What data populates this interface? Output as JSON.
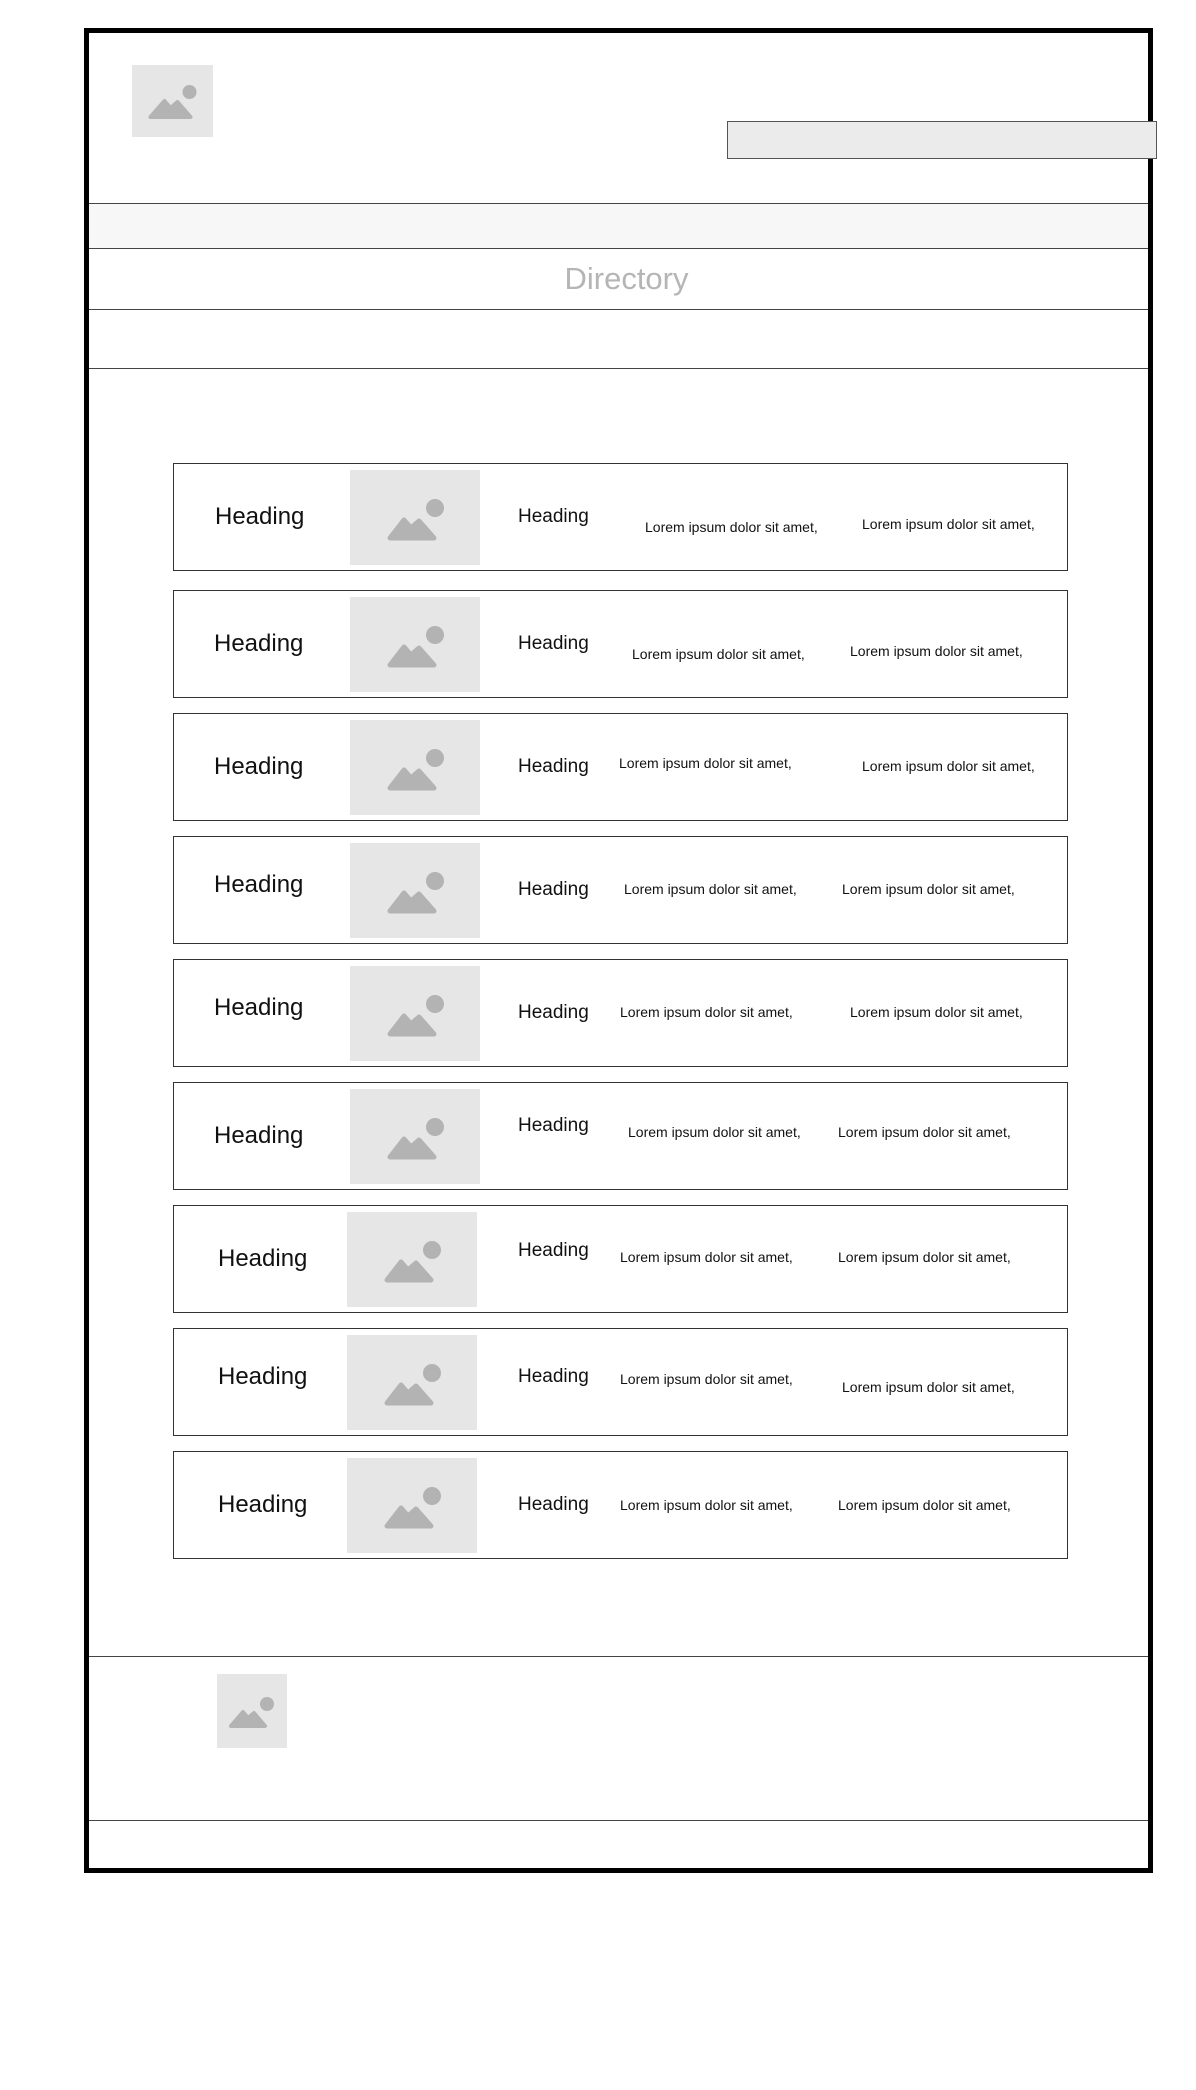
{
  "page": {
    "title": "Directory",
    "search": {
      "value": "",
      "placeholder": ""
    }
  },
  "rows": [
    {
      "heading": "Heading",
      "subheading": "Heading",
      "text_1": "Lorem ipsum dolor sit amet,",
      "text_2": "Lorem ipsum dolor sit amet,"
    },
    {
      "heading": "Heading",
      "subheading": "Heading",
      "text_1": "Lorem ipsum dolor sit amet,",
      "text_2": "Lorem ipsum dolor sit amet,"
    },
    {
      "heading": "Heading",
      "subheading": "Heading",
      "text_1": "Lorem ipsum dolor sit amet,",
      "text_2": "Lorem ipsum dolor sit amet,"
    },
    {
      "heading": "Heading",
      "subheading": "Heading",
      "text_1": "Lorem ipsum dolor sit amet,",
      "text_2": "Lorem ipsum dolor sit amet,"
    },
    {
      "heading": "Heading",
      "subheading": "Heading",
      "text_1": "Lorem ipsum dolor sit amet,",
      "text_2": "Lorem ipsum dolor sit amet,"
    },
    {
      "heading": "Heading",
      "subheading": "Heading",
      "text_1": "Lorem ipsum dolor sit amet,",
      "text_2": "Lorem ipsum dolor sit amet,"
    },
    {
      "heading": "Heading",
      "subheading": "Heading",
      "text_1": "Lorem ipsum dolor sit amet,",
      "text_2": "Lorem ipsum dolor sit amet,"
    },
    {
      "heading": "Heading",
      "subheading": "Heading",
      "text_1": "Lorem ipsum dolor sit amet,",
      "text_2": "Lorem ipsum dolor sit amet,"
    },
    {
      "heading": "Heading",
      "subheading": "Heading",
      "text_1": "Lorem ipsum dolor sit amet,",
      "text_2": "Lorem ipsum dolor sit amet,"
    }
  ],
  "icons": {
    "logo": "image-placeholder-icon",
    "row_thumbnail": "image-placeholder-icon",
    "footer_logo": "image-placeholder-icon"
  },
  "colors": {
    "placeholder_bg": "#e6e6e6",
    "placeholder_glyph": "#b3b3b3",
    "title_text": "#b5b5b5",
    "search_bg": "#ebebeb",
    "nav_band_bg": "#f7f7f7"
  }
}
